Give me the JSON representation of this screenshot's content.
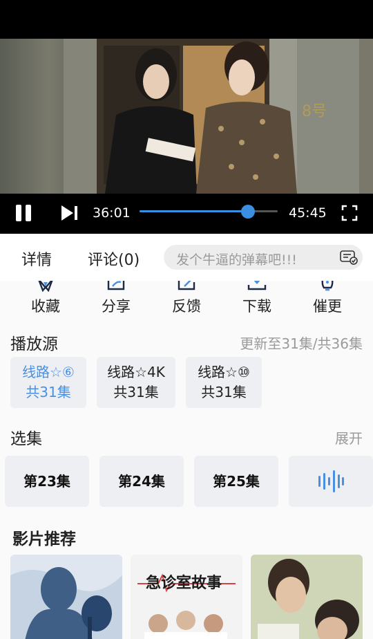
{
  "player": {
    "current_time": "36:01",
    "total_time": "45:45",
    "progress": 0.7869,
    "door_sign": "8号"
  },
  "tabs": {
    "details": "详情",
    "comments": "评论(0)",
    "danmu_placeholder": "发个牛逼的弹幕吧!!!"
  },
  "actions": [
    {
      "label": "收藏",
      "icon": "star-icon"
    },
    {
      "label": "分享",
      "icon": "share-icon"
    },
    {
      "label": "反馈",
      "icon": "edit-icon"
    },
    {
      "label": "下载",
      "icon": "download-icon"
    },
    {
      "label": "催更",
      "icon": "urge-icon"
    }
  ],
  "sources": {
    "title": "播放源",
    "update_info": "更新至31集/共36集",
    "items": [
      {
        "name": "线路☆⑥",
        "count": "共31集",
        "active": true
      },
      {
        "name": "线路☆4K",
        "count": "共31集",
        "active": false
      },
      {
        "name": "线路☆⑩",
        "count": "共31集",
        "active": false
      }
    ]
  },
  "episodes": {
    "title": "选集",
    "expand": "展开",
    "items": [
      "第23集",
      "第24集",
      "第25集"
    ],
    "playing_icon": "sound-wave-icon",
    "accent": "#4a90e2"
  },
  "recommend": {
    "title": "影片推荐",
    "posters": [
      {
        "title": ""
      },
      {
        "title": "急诊室故事"
      },
      {
        "title": ""
      }
    ]
  },
  "colors": {
    "accent": "#3a8fe0",
    "background": "#fafafb",
    "chip": "#eeeff2"
  }
}
